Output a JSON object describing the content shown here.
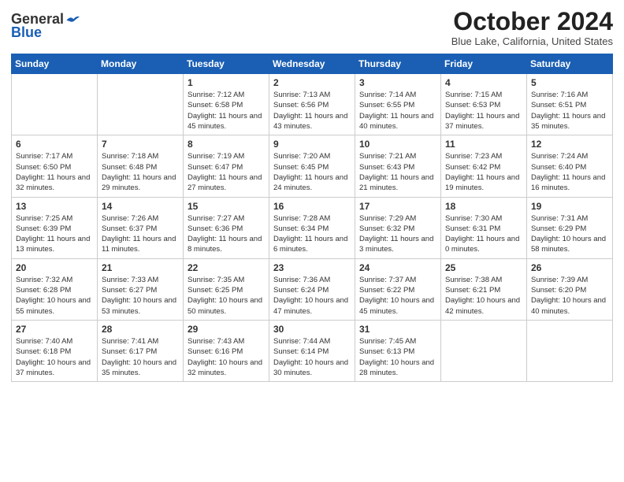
{
  "header": {
    "logo_general": "General",
    "logo_blue": "Blue",
    "month_title": "October 2024",
    "location": "Blue Lake, California, United States"
  },
  "weekdays": [
    "Sunday",
    "Monday",
    "Tuesday",
    "Wednesday",
    "Thursday",
    "Friday",
    "Saturday"
  ],
  "weeks": [
    [
      {
        "day": "",
        "info": ""
      },
      {
        "day": "",
        "info": ""
      },
      {
        "day": "1",
        "info": "Sunrise: 7:12 AM\nSunset: 6:58 PM\nDaylight: 11 hours and 45 minutes."
      },
      {
        "day": "2",
        "info": "Sunrise: 7:13 AM\nSunset: 6:56 PM\nDaylight: 11 hours and 43 minutes."
      },
      {
        "day": "3",
        "info": "Sunrise: 7:14 AM\nSunset: 6:55 PM\nDaylight: 11 hours and 40 minutes."
      },
      {
        "day": "4",
        "info": "Sunrise: 7:15 AM\nSunset: 6:53 PM\nDaylight: 11 hours and 37 minutes."
      },
      {
        "day": "5",
        "info": "Sunrise: 7:16 AM\nSunset: 6:51 PM\nDaylight: 11 hours and 35 minutes."
      }
    ],
    [
      {
        "day": "6",
        "info": "Sunrise: 7:17 AM\nSunset: 6:50 PM\nDaylight: 11 hours and 32 minutes."
      },
      {
        "day": "7",
        "info": "Sunrise: 7:18 AM\nSunset: 6:48 PM\nDaylight: 11 hours and 29 minutes."
      },
      {
        "day": "8",
        "info": "Sunrise: 7:19 AM\nSunset: 6:47 PM\nDaylight: 11 hours and 27 minutes."
      },
      {
        "day": "9",
        "info": "Sunrise: 7:20 AM\nSunset: 6:45 PM\nDaylight: 11 hours and 24 minutes."
      },
      {
        "day": "10",
        "info": "Sunrise: 7:21 AM\nSunset: 6:43 PM\nDaylight: 11 hours and 21 minutes."
      },
      {
        "day": "11",
        "info": "Sunrise: 7:23 AM\nSunset: 6:42 PM\nDaylight: 11 hours and 19 minutes."
      },
      {
        "day": "12",
        "info": "Sunrise: 7:24 AM\nSunset: 6:40 PM\nDaylight: 11 hours and 16 minutes."
      }
    ],
    [
      {
        "day": "13",
        "info": "Sunrise: 7:25 AM\nSunset: 6:39 PM\nDaylight: 11 hours and 13 minutes."
      },
      {
        "day": "14",
        "info": "Sunrise: 7:26 AM\nSunset: 6:37 PM\nDaylight: 11 hours and 11 minutes."
      },
      {
        "day": "15",
        "info": "Sunrise: 7:27 AM\nSunset: 6:36 PM\nDaylight: 11 hours and 8 minutes."
      },
      {
        "day": "16",
        "info": "Sunrise: 7:28 AM\nSunset: 6:34 PM\nDaylight: 11 hours and 6 minutes."
      },
      {
        "day": "17",
        "info": "Sunrise: 7:29 AM\nSunset: 6:32 PM\nDaylight: 11 hours and 3 minutes."
      },
      {
        "day": "18",
        "info": "Sunrise: 7:30 AM\nSunset: 6:31 PM\nDaylight: 11 hours and 0 minutes."
      },
      {
        "day": "19",
        "info": "Sunrise: 7:31 AM\nSunset: 6:29 PM\nDaylight: 10 hours and 58 minutes."
      }
    ],
    [
      {
        "day": "20",
        "info": "Sunrise: 7:32 AM\nSunset: 6:28 PM\nDaylight: 10 hours and 55 minutes."
      },
      {
        "day": "21",
        "info": "Sunrise: 7:33 AM\nSunset: 6:27 PM\nDaylight: 10 hours and 53 minutes."
      },
      {
        "day": "22",
        "info": "Sunrise: 7:35 AM\nSunset: 6:25 PM\nDaylight: 10 hours and 50 minutes."
      },
      {
        "day": "23",
        "info": "Sunrise: 7:36 AM\nSunset: 6:24 PM\nDaylight: 10 hours and 47 minutes."
      },
      {
        "day": "24",
        "info": "Sunrise: 7:37 AM\nSunset: 6:22 PM\nDaylight: 10 hours and 45 minutes."
      },
      {
        "day": "25",
        "info": "Sunrise: 7:38 AM\nSunset: 6:21 PM\nDaylight: 10 hours and 42 minutes."
      },
      {
        "day": "26",
        "info": "Sunrise: 7:39 AM\nSunset: 6:20 PM\nDaylight: 10 hours and 40 minutes."
      }
    ],
    [
      {
        "day": "27",
        "info": "Sunrise: 7:40 AM\nSunset: 6:18 PM\nDaylight: 10 hours and 37 minutes."
      },
      {
        "day": "28",
        "info": "Sunrise: 7:41 AM\nSunset: 6:17 PM\nDaylight: 10 hours and 35 minutes."
      },
      {
        "day": "29",
        "info": "Sunrise: 7:43 AM\nSunset: 6:16 PM\nDaylight: 10 hours and 32 minutes."
      },
      {
        "day": "30",
        "info": "Sunrise: 7:44 AM\nSunset: 6:14 PM\nDaylight: 10 hours and 30 minutes."
      },
      {
        "day": "31",
        "info": "Sunrise: 7:45 AM\nSunset: 6:13 PM\nDaylight: 10 hours and 28 minutes."
      },
      {
        "day": "",
        "info": ""
      },
      {
        "day": "",
        "info": ""
      }
    ]
  ]
}
